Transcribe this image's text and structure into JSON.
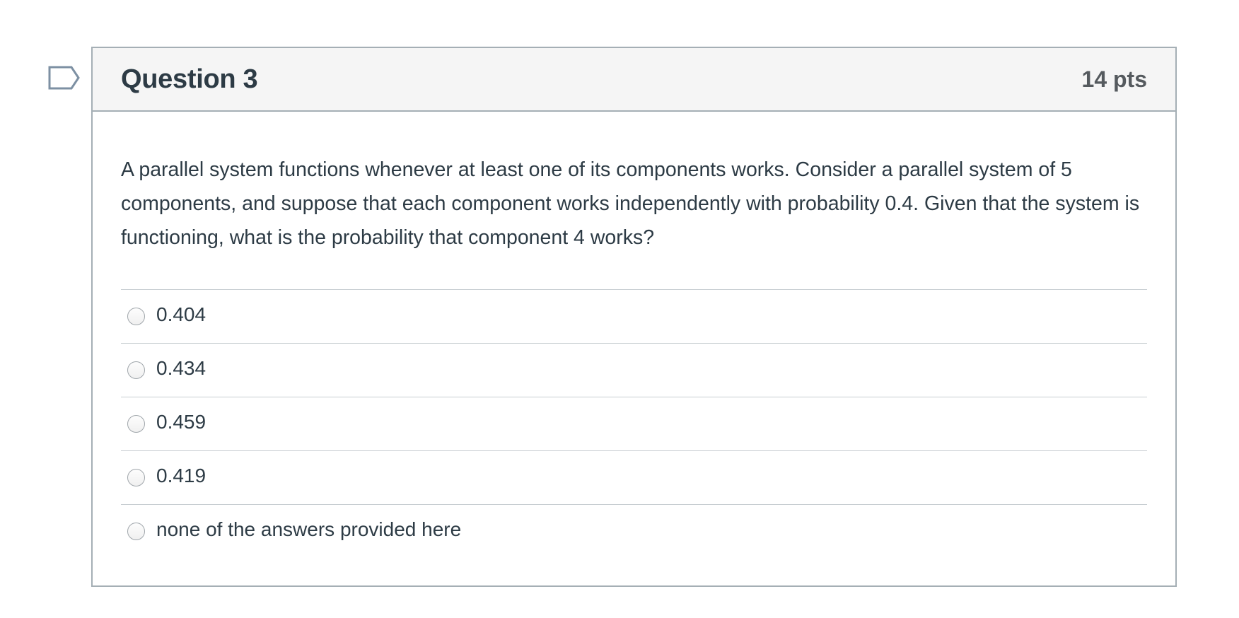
{
  "question": {
    "flag_icon": "flag-outline-icon",
    "title": "Question 3",
    "points": "14 pts",
    "text": "A parallel system functions whenever at least one of its components works. Consider a parallel system of 5 components, and suppose that each component works independently with probability 0.4. Given that the system is functioning, what is the probability that component 4 works?",
    "answers": [
      {
        "label": "0.404",
        "selected": false
      },
      {
        "label": "0.434",
        "selected": false
      },
      {
        "label": "0.459",
        "selected": false
      },
      {
        "label": "0.419",
        "selected": false
      },
      {
        "label": "none of the answers provided here",
        "selected": false
      }
    ]
  },
  "colors": {
    "border": "#a5afb5",
    "header_bg": "#f5f5f5",
    "text": "#2d3b45",
    "flag_stroke": "#7d90a3"
  }
}
